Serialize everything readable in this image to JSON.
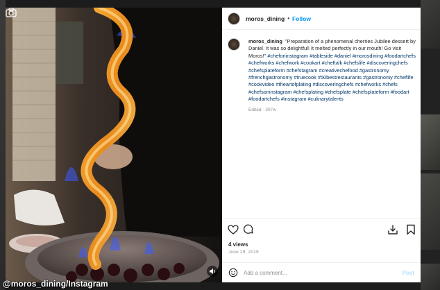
{
  "post": {
    "username": "moros_dining",
    "follow_label": "Follow",
    "header_separator": "•",
    "caption_text": "\"Preparation of a phenomenal cherries Jubilee dessert by Daniel. It was so delightful! It melted perfectly in our mouth! Go visit Moros!\"",
    "caption_tags": "#chefoninstagram #tableside #daniel #morosdining #foodartchefs #chefworks #chefwork #cookart #cheftalk #chefslife #discoveringchefs #chefsplateform #chefstagram #creativechefood #gastronomy #frenchgastronomy #truecook #50bestrestaurants #gastronomy #cheflife #cookvideo #theartofplating #discoveringchefs #chefworks #chefs #chefsoninstagram #chefsplating #chefsplate #chefsplateform #foodart #foodartchefs #instagram #culinarytalents",
    "edited_label": "Edited · 307w",
    "views": "4 views",
    "date": "June 29, 2019"
  },
  "comment": {
    "placeholder": "Add a comment...",
    "post_label": "Post"
  },
  "media": {
    "credit": "@moros_dining/Instagram"
  },
  "icons": {
    "like": "heart-icon",
    "comment": "comment-icon",
    "share": "share-icon",
    "save": "bookmark-icon",
    "emoji": "emoji-icon",
    "camera": "camera-icon",
    "sound": "speaker-icon"
  },
  "colors": {
    "link_blue": "#0095f6",
    "hashtag": "#00376b",
    "muted": "#8e8e8e",
    "post_disabled": "#b2dffc"
  }
}
